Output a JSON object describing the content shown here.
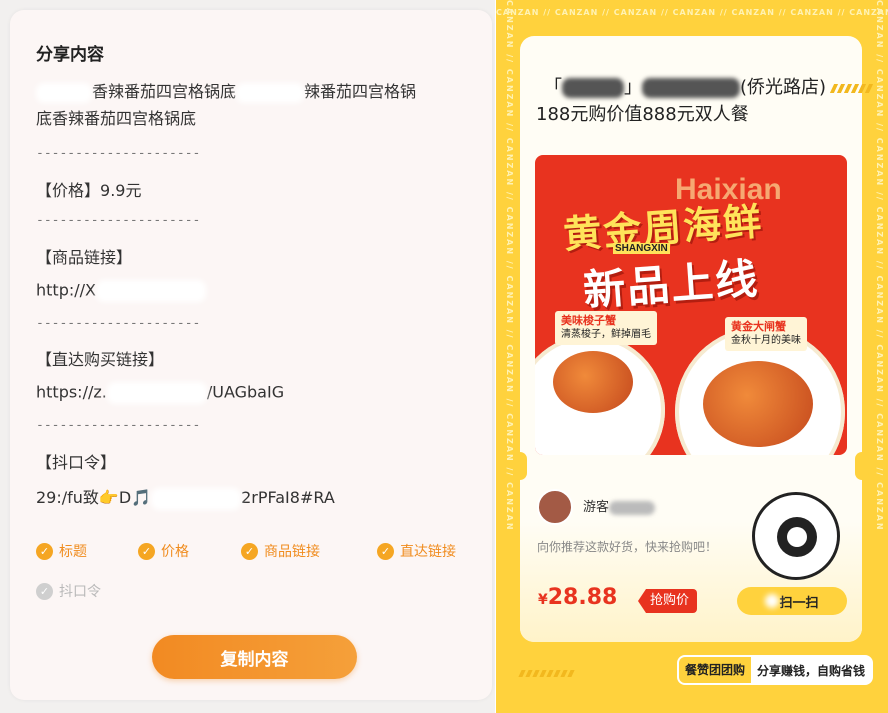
{
  "share": {
    "title": "分享内容",
    "text_line1": "香辣番茄四宫格锅底",
    "text_line1b": "辣番茄四宫格锅",
    "text_line2": "底香辣番茄四宫格锅底",
    "divider": "---------------------",
    "price_label": "【价格】",
    "price_value": "9.9元",
    "product_link_label": "【商品链接】",
    "product_link_value": "http://X",
    "direct_link_label": "【直达购买链接】",
    "direct_link_prefix": "https://z.",
    "direct_link_suffix": "/UAGbaIG",
    "douyin_label": "【抖口令】",
    "douyin_prefix": "29:/fu致👉D🎵",
    "douyin_suffix": "2rPFaI8#RA"
  },
  "options": [
    {
      "label": "标题",
      "checked": true
    },
    {
      "label": "价格",
      "checked": true
    },
    {
      "label": "商品链接",
      "checked": true
    },
    {
      "label": "直达链接",
      "checked": true
    },
    {
      "label": "抖口令",
      "checked": false
    }
  ],
  "copy_button": "复制内容",
  "poster": {
    "watermark": "CANZAN",
    "shop_name_start": "「",
    "shop_name_end": "」",
    "shop_name_tail": "(侨光路店)",
    "offer": "188元购价值888元双人餐",
    "banner": {
      "en_word": "Haixian",
      "headline1": "黄金周海鲜",
      "sub_en": "SHANGXIN",
      "headline2": "新品上线",
      "tag1_title": "美味梭子蟹",
      "tag1_desc": "清蒸梭子，鲜掉眉毛",
      "tag2_title": "黄金大闸蟹",
      "tag2_desc": "金秋十月的美味"
    },
    "username": "游客",
    "recommend": "向你推荐这款好货，快来抢购吧！",
    "price_symbol": "¥",
    "price": "28.88",
    "buy_tag": "抢购价",
    "scan_button": "扫一扫",
    "footer_brand": "餐赞团团购",
    "footer_slogan": "分享赚钱，自购省钱"
  },
  "colors": {
    "accent_orange": "#f28a22",
    "poster_yellow": "#ffd23d",
    "price_red": "#e8331f"
  }
}
